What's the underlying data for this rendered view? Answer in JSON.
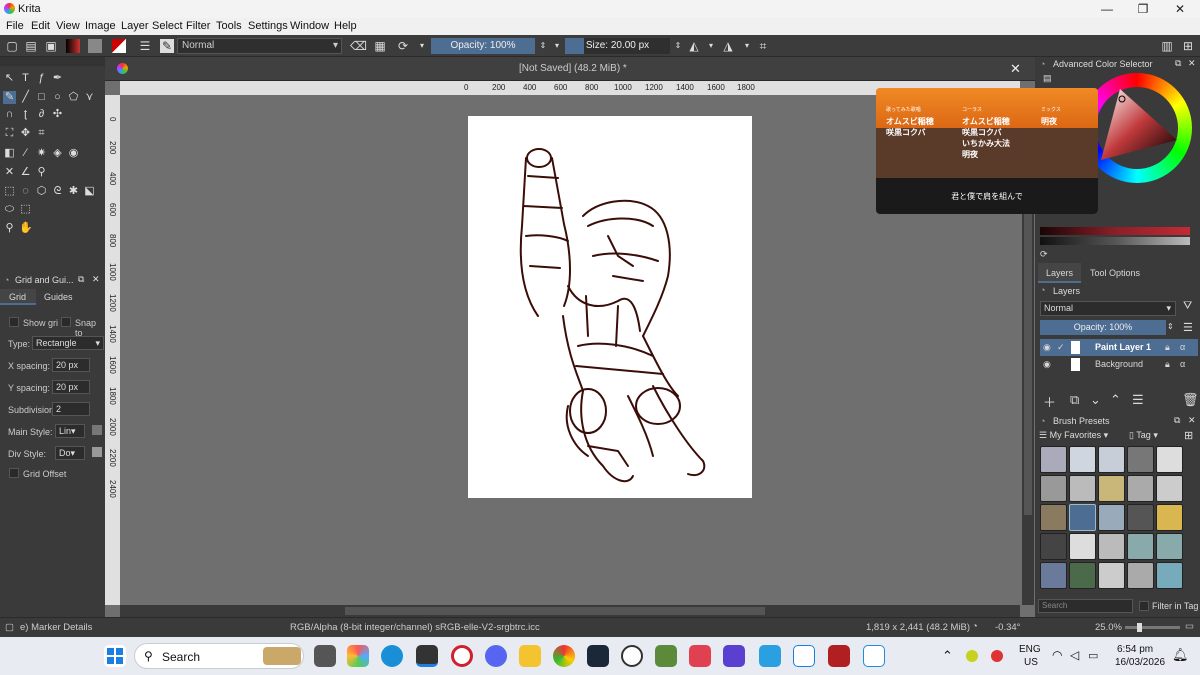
{
  "window": {
    "title": "Krita",
    "min": "—",
    "max": "❐",
    "close": "✕"
  },
  "menu": [
    "File",
    "Edit",
    "View",
    "Image",
    "Layer",
    "Select",
    "Filter",
    "Tools",
    "Settings",
    "Window",
    "Help"
  ],
  "toolbar": {
    "blend_mode": "Normal",
    "opacity": "Opacity: 100%",
    "size": "Size: 20.00 px"
  },
  "document": {
    "tab_title": "[Not Saved]  (48.2 MiB) *",
    "close": "✕"
  },
  "ruler_top": [
    "0",
    "200",
    "400",
    "600",
    "800",
    "1000",
    "1200",
    "1400",
    "1600",
    "1800"
  ],
  "ruler_left": [
    "0",
    "200",
    "400",
    "600",
    "800",
    "1000",
    "1200",
    "1400",
    "1600",
    "1800",
    "2000",
    "2200",
    "2400"
  ],
  "grid_panel": {
    "title": "Grid and Gui...",
    "tabs": [
      "Grid",
      "Guides"
    ],
    "show_grid": "Show gri",
    "snap": "Snap to",
    "type_label": "Type:",
    "type_value": "Rectangle",
    "x_spacing_label": "X spacing:",
    "x_spacing": "20 px",
    "y_spacing_label": "Y spacing:",
    "y_spacing": "20 px",
    "subdivision_label": "Subdivision",
    "subdivision": "2",
    "main_style_label": "Main Style:",
    "main_style": "Lin",
    "div_style_label": "Div Style:",
    "div_style": "Do",
    "grid_offset": "Grid Offset"
  },
  "color_selector": {
    "title": "Advanced Color Selector"
  },
  "overlay": {
    "col1": [
      "歌ってみた歌唱",
      "オムスビ稲穂",
      "咲黒コクバ"
    ],
    "col2": [
      "コーラス",
      "オムスビ稲穂",
      "咲黒コクバ",
      "いちかみ大法",
      "明夜"
    ],
    "col3": [
      "ミックス",
      "明夜"
    ],
    "caption": "君と僕で肩を組んで"
  },
  "layers_panel": {
    "tabs": [
      "Layers",
      "Tool Options"
    ],
    "title": "Layers",
    "blend": "Normal",
    "opacity": "Opacity:  100%",
    "layers": [
      "Paint Layer 1",
      "Background"
    ]
  },
  "brush_presets": {
    "title": "Brush Presets",
    "tag_filter": "My Favorites",
    "tag_label": "Tag",
    "search_placeholder": "Search",
    "filter_in_tag": "Filter in Tag"
  },
  "status": {
    "brush": "e) Marker Details",
    "color_space": "RGB/Alpha (8-bit integer/channel)  sRGB-elle-V2-srgbtrc.icc",
    "dimensions": "1,819 x 2,441 (48.2 MiB)",
    "rotation": "-0.34°",
    "zoom": "25.0%"
  },
  "taskbar": {
    "search": "Search",
    "lang1": "ENG",
    "lang2": "US",
    "time": "6:54 pm",
    "date": "16/03/2026"
  },
  "colors": {
    "accent": "#4d6d93",
    "canvas_bg": "#6f6f6f",
    "sketch": "#3a0d08"
  }
}
